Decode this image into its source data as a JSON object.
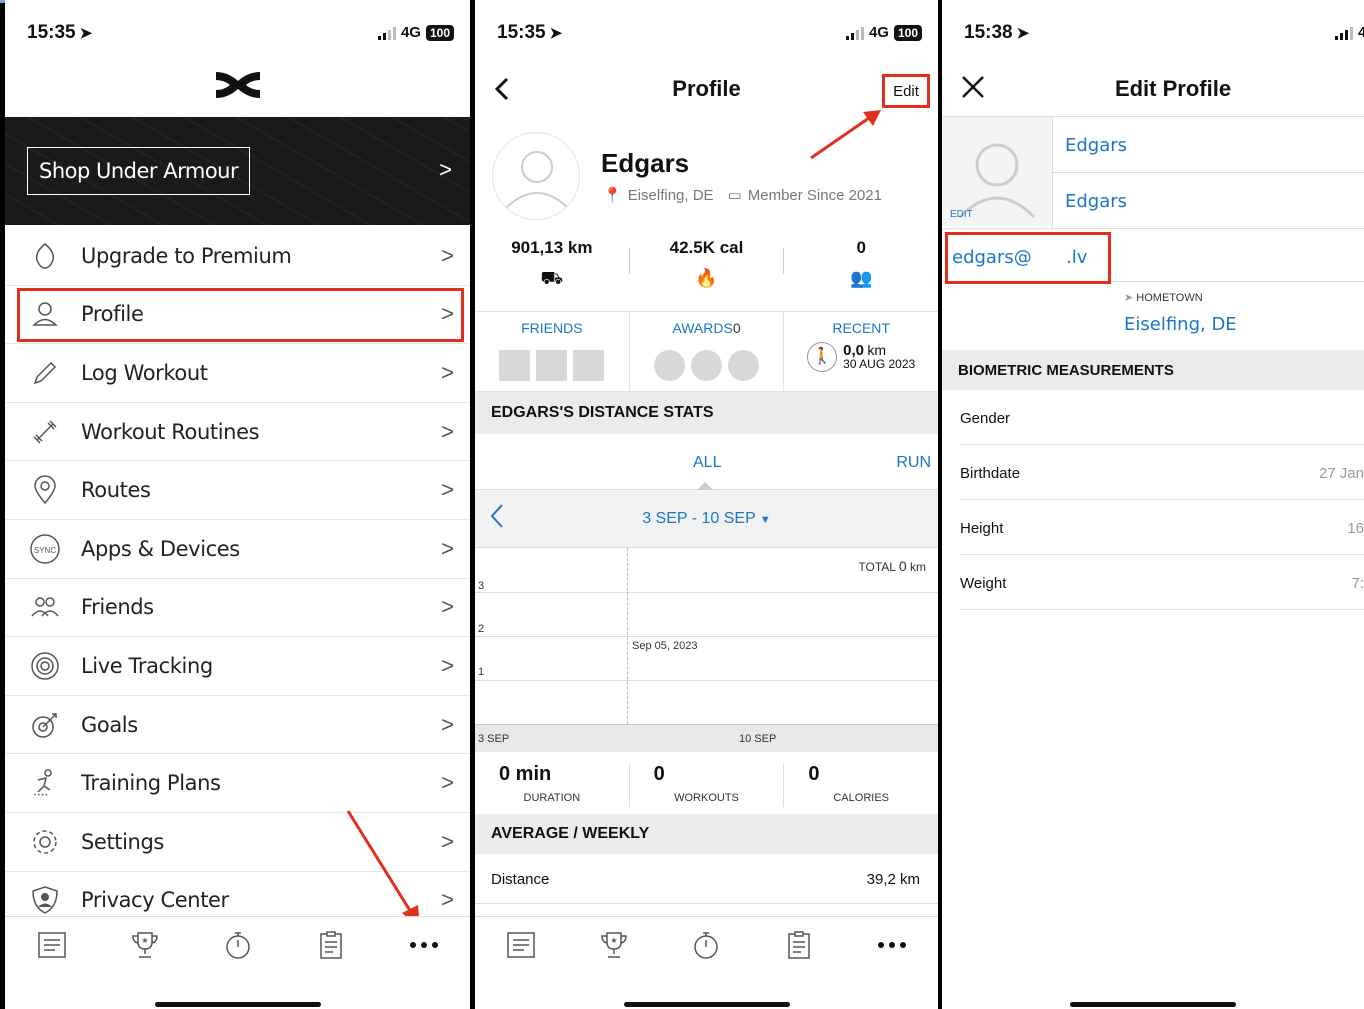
{
  "status": {
    "p1_time": "15:35",
    "p2_time": "15:35",
    "p3_time": "15:38",
    "network": "4G",
    "battery": "100"
  },
  "menu_panel": {
    "shop_label": "Shop Under Armour",
    "items": [
      {
        "label": "Upgrade to Premium",
        "icon": "premium-icon"
      },
      {
        "label": "Profile",
        "icon": "person-icon"
      },
      {
        "label": "Log Workout",
        "icon": "pencil-icon"
      },
      {
        "label": "Workout Routines",
        "icon": "dumbbell-icon"
      },
      {
        "label": "Routes",
        "icon": "map-pin-icon"
      },
      {
        "label": "Apps & Devices",
        "icon": "sync-icon"
      },
      {
        "label": "Friends",
        "icon": "friends-icon"
      },
      {
        "label": "Live Tracking",
        "icon": "live-tracking-icon"
      },
      {
        "label": "Goals",
        "icon": "target-icon"
      },
      {
        "label": "Training Plans",
        "icon": "runner-icon"
      },
      {
        "label": "Settings",
        "icon": "gear-icon"
      },
      {
        "label": "Privacy Center",
        "icon": "shield-icon"
      }
    ]
  },
  "bottom_nav": [
    "feed-icon",
    "trophy-icon",
    "stopwatch-icon",
    "clipboard-icon",
    "more-icon"
  ],
  "profile_panel": {
    "title": "Profile",
    "edit_label": "Edit",
    "name": "Edgars",
    "location": "Eiselfing, DE",
    "member_since": "Member Since 2021",
    "stats": [
      {
        "value": "901,13 km",
        "icon": "road-icon"
      },
      {
        "value": "42.5K cal",
        "icon": "flame-icon"
      },
      {
        "value": "0",
        "icon": "people-icon"
      }
    ],
    "friends_label": "FRIENDS",
    "awards_label": "AWARDS",
    "awards_count": "0",
    "recent_label": "RECENT",
    "recent_distance": "0,0",
    "recent_unit": "km",
    "recent_date": "30 AUG 2023",
    "distance_stats_title": "EDGARS'S DISTANCE STATS",
    "tab_all": "ALL",
    "tab_run": "RUN",
    "week_range": "3 SEP - 10 SEP",
    "total_label": "TOTAL",
    "total_value": "0",
    "total_unit": "km",
    "y_ticks": [
      "3",
      "2",
      "1"
    ],
    "chart_date_label": "Sep 05, 2023",
    "x_start": "3 SEP",
    "x_end": "10 SEP",
    "summary": [
      {
        "value": "0 min",
        "label": "DURATION"
      },
      {
        "value": "0",
        "label": "WORKOUTS"
      },
      {
        "value": "0",
        "label": "CALORIES"
      }
    ],
    "avg_title": "AVERAGE / WEEKLY",
    "distance_label": "Distance",
    "distance_value": "39,2 km"
  },
  "edit_panel": {
    "title": "Edit Profile",
    "edit_photo": "EDIT",
    "first_name": "Edgars",
    "last_name": "Edgars",
    "email": "edgars@      .lv",
    "hometown_label": "HOMETOWN",
    "hometown": "Eiselfing, DE",
    "bio_title": "BIOMETRIC MEASUREMENTS",
    "rows": [
      {
        "label": "Gender",
        "value": ""
      },
      {
        "label": "Birthdate",
        "value": "27 Jan"
      },
      {
        "label": "Height",
        "value": "16"
      },
      {
        "label": "Weight",
        "value": "7:"
      }
    ]
  },
  "colors": {
    "accent": "#1976c8",
    "highlight": "#e0301e"
  }
}
